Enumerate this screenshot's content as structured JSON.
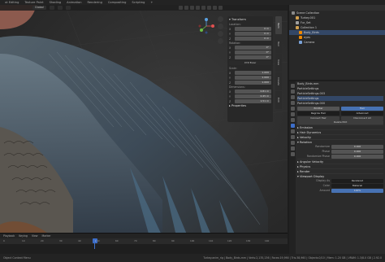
{
  "topbar": {
    "items": [
      "ut Editing",
      "Texture Paint",
      "Shading",
      "Animation",
      "Rendering",
      "Compositing",
      "Scripting",
      "+"
    ]
  },
  "viewport": {
    "header_chips": [
      "Global",
      "",
      "",
      ""
    ],
    "npanel": {
      "transform_label": "Transform",
      "location_label": "Location:",
      "location": [
        [
          "X",
          "0 m"
        ],
        [
          "Y",
          "0 m"
        ],
        [
          "Z",
          "0 m"
        ]
      ],
      "rotation_label": "Rotation:",
      "rotation": [
        [
          "X",
          "0°"
        ],
        [
          "Y",
          "0°"
        ],
        [
          "Z",
          "0°"
        ]
      ],
      "rotation_mode": "XYZ Euler",
      "scale_label": "Scale:",
      "scale": [
        [
          "X",
          "1.000"
        ],
        [
          "Y",
          "1.000"
        ],
        [
          "Z",
          "1.000"
        ]
      ],
      "dimensions_label": "Dimensions:",
      "dimensions": [
        [
          "X",
          "0.81 m"
        ],
        [
          "Y",
          "0.45 m"
        ],
        [
          "Z",
          "1.51 m"
        ]
      ],
      "properties_label": "Properties"
    },
    "ntabs": [
      "Item",
      "Tool",
      "View",
      "Create",
      "Edit"
    ]
  },
  "timeline": {
    "head": [
      "Playback",
      "Keying",
      "View",
      "Marker"
    ],
    "ticks": [
      "0",
      "10",
      "20",
      "30",
      "40",
      "50",
      "60",
      "70",
      "80",
      "90",
      "100",
      "110",
      "120",
      "130",
      "140"
    ],
    "current_frame": "1"
  },
  "outliner": {
    "rows": [
      {
        "label": "Scene Collection",
        "color": "#8a8a8a",
        "sel": false
      },
      {
        "label": "Turkey.001",
        "color": "#d0a050",
        "sel": false
      },
      {
        "label": "Fur_Set",
        "color": "#a0a0a0",
        "sel": false
      },
      {
        "label": "Collection 1",
        "color": "#d0a050",
        "sel": false
      },
      {
        "label": "Body_Birds",
        "color": "#ee8800",
        "sel": true
      },
      {
        "label": "eyes",
        "color": "#ee8800",
        "sel": false
      },
      {
        "label": "Camera",
        "color": "#7aa2d8",
        "sel": false
      }
    ]
  },
  "properties": {
    "search": "Body_Birds.mm",
    "tab_label": "ParticleSettings",
    "systems": [
      "ParticleSettings.003",
      "ParticleSettings"
    ],
    "settings_label": "ParticleSettings.000",
    "emitter": "Emitter",
    "hair": "Hair",
    "regrow": "Regrow Hair",
    "advanced": "Advanced",
    "buttons": [
      "Connect Hair",
      "Disconnect All",
      "Delete Edit"
    ],
    "sections": [
      "Emission",
      "Hair Dynamics",
      "Velocity",
      "Rotation",
      "Angular Velocity",
      "Physics",
      "Render",
      "Viewport Display"
    ],
    "rotation_fields": [
      [
        "Randomize",
        "0.000"
      ],
      [
        "Phase",
        "0.000"
      ],
      [
        "Randomize Phase",
        "0.000"
      ]
    ],
    "display_as": "Rendered",
    "color_label": "Color",
    "color_val": "Material",
    "amount_label": "Amount",
    "amount_val": "100%",
    "display_label": "Display As"
  },
  "statusbar": {
    "left": "Object Context Menu",
    "right": "Turkey.anim_rig | Body_Birds.mm | Verts:2,135,136 | Faces:19,990 | Tris:38,960 | Objects:0/10 | Mem: 1.20 GB | VRAM: 1.3/8.0 GB | 2.92.0"
  },
  "colors": {
    "accent": "#4772b3",
    "selected": "#334766"
  }
}
